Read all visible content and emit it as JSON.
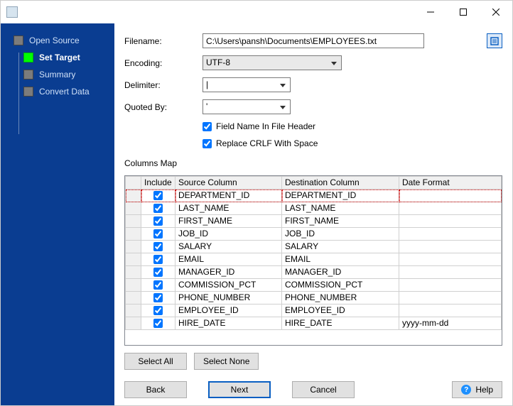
{
  "titlebar": {
    "title": ""
  },
  "nav": {
    "items": [
      {
        "label": "Open Source"
      },
      {
        "label": "Set Target"
      },
      {
        "label": "Summary"
      },
      {
        "label": "Convert Data"
      }
    ]
  },
  "form": {
    "filename_label": "Filename:",
    "filename_value": "C:\\Users\\pansh\\Documents\\EMPLOYEES.txt",
    "encoding_label": "Encoding:",
    "encoding_value": "UTF-8",
    "delimiter_label": "Delimiter:",
    "delimiter_value": "|",
    "quoted_label": "Quoted By:",
    "quoted_value": "'",
    "chk_header_label": "Field Name In File Header",
    "chk_header_checked": true,
    "chk_crlf_label": "Replace CRLF With Space",
    "chk_crlf_checked": true,
    "columns_map_label": "Columns Map"
  },
  "table": {
    "headers": {
      "include": "Include",
      "source": "Source Column",
      "destination": "Destination Column",
      "date_format": "Date Format"
    },
    "rows": [
      {
        "include": true,
        "source": "DEPARTMENT_ID",
        "destination": "DEPARTMENT_ID",
        "date_format": ""
      },
      {
        "include": true,
        "source": "LAST_NAME",
        "destination": "LAST_NAME",
        "date_format": ""
      },
      {
        "include": true,
        "source": "FIRST_NAME",
        "destination": "FIRST_NAME",
        "date_format": ""
      },
      {
        "include": true,
        "source": "JOB_ID",
        "destination": "JOB_ID",
        "date_format": ""
      },
      {
        "include": true,
        "source": "SALARY",
        "destination": "SALARY",
        "date_format": ""
      },
      {
        "include": true,
        "source": "EMAIL",
        "destination": "EMAIL",
        "date_format": ""
      },
      {
        "include": true,
        "source": "MANAGER_ID",
        "destination": "MANAGER_ID",
        "date_format": ""
      },
      {
        "include": true,
        "source": "COMMISSION_PCT",
        "destination": "COMMISSION_PCT",
        "date_format": ""
      },
      {
        "include": true,
        "source": "PHONE_NUMBER",
        "destination": "PHONE_NUMBER",
        "date_format": ""
      },
      {
        "include": true,
        "source": "EMPLOYEE_ID",
        "destination": "EMPLOYEE_ID",
        "date_format": ""
      },
      {
        "include": true,
        "source": "HIRE_DATE",
        "destination": "HIRE_DATE",
        "date_format": "yyyy-mm-dd"
      }
    ]
  },
  "buttons": {
    "select_all": "Select All",
    "select_none": "Select None",
    "back": "Back",
    "next": "Next",
    "cancel": "Cancel",
    "help": "Help"
  }
}
